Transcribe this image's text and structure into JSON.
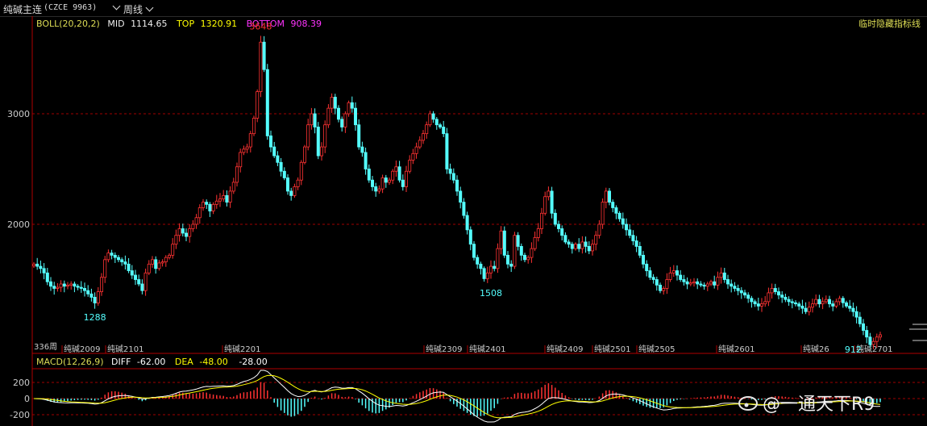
{
  "header": {
    "instrument": "纯碱主连",
    "code": "(CZCE 9963)",
    "period": "周线"
  },
  "boll": {
    "label": "BOLL(20,20,2)",
    "mid_label": "MID",
    "mid": "1114.65",
    "top_label": "TOP",
    "top": "1320.91",
    "bottom_label": "BOTTOM",
    "bottom": "908.39"
  },
  "hide_indicator_label": "临时隐藏指标线",
  "macd": {
    "label": "MACD(12,26,9)",
    "diff_label": "DIFF",
    "diff": "-62.00",
    "dea_label": "DEA",
    "dea": "-48.00",
    "bar_value": "-28.00"
  },
  "bar_count_label": "336周",
  "watermark": "@一通天下R9",
  "colors": {
    "up": "#ff3232",
    "down": "#54ffff",
    "grid": "#b00000",
    "axis": "#b00000",
    "diff": "#ffffff",
    "dea": "#ffff00"
  },
  "chart_data": [
    {
      "type": "candlestick",
      "price_ylim": [
        1000,
        3700
      ],
      "y_ticks": [
        "3000",
        "2000"
      ],
      "annotations": [
        {
          "label": "3648",
          "index": 67,
          "value": 3648
        },
        {
          "label": "1288",
          "index": 18,
          "value": 1288
        },
        {
          "label": "1508",
          "index": 135,
          "value": 1508
        },
        {
          "label": "912",
          "index": 242,
          "value": 912
        }
      ],
      "x_labels": [
        "纯碱2009",
        "纯碱2101",
        "纯碱2201",
        "纯碱2309",
        "纯碱2401",
        "纯碱2409",
        "纯碱2501",
        "纯碱2505",
        "纯碱2601",
        "纯碱26",
        "纯碱2701"
      ],
      "closes": [
        1640,
        1620,
        1600,
        1560,
        1480,
        1440,
        1420,
        1430,
        1460,
        1440,
        1450,
        1460,
        1440,
        1430,
        1420,
        1400,
        1370,
        1340,
        1288,
        1390,
        1520,
        1680,
        1740,
        1720,
        1700,
        1680,
        1660,
        1640,
        1580,
        1540,
        1500,
        1460,
        1400,
        1560,
        1640,
        1680,
        1600,
        1650,
        1660,
        1700,
        1720,
        1820,
        1900,
        1960,
        1920,
        1890,
        1960,
        2000,
        2060,
        2150,
        2200,
        2180,
        2120,
        2180,
        2210,
        2230,
        2260,
        2200,
        2300,
        2380,
        2520,
        2650,
        2680,
        2700,
        2820,
        2960,
        3200,
        3648,
        3400,
        2800,
        2700,
        2620,
        2560,
        2480,
        2420,
        2300,
        2260,
        2340,
        2400,
        2560,
        2700,
        2900,
        3000,
        2880,
        2620,
        2700,
        2900,
        3050,
        3150,
        3050,
        2950,
        2880,
        3000,
        3100,
        3050,
        2900,
        2700,
        2650,
        2500,
        2400,
        2340,
        2300,
        2320,
        2420,
        2380,
        2400,
        2480,
        2520,
        2400,
        2340,
        2480,
        2580,
        2640,
        2700,
        2760,
        2820,
        2900,
        3000,
        2950,
        2900,
        2880,
        2820,
        2500,
        2460,
        2400,
        2300,
        2200,
        2080,
        1950,
        1820,
        1700,
        1640,
        1600,
        1508,
        1560,
        1620,
        1600,
        1780,
        1940,
        1720,
        1640,
        1620,
        1900,
        1800,
        1720,
        1680,
        1700,
        1780,
        1880,
        1960,
        2100,
        2250,
        2300,
        2100,
        2000,
        1960,
        1900,
        1840,
        1820,
        1780,
        1820,
        1780,
        1840,
        1800,
        1760,
        1820,
        1900,
        2000,
        2200,
        2300,
        2200,
        2150,
        2100,
        2050,
        2000,
        1950,
        1900,
        1850,
        1800,
        1720,
        1640,
        1580,
        1520,
        1500,
        1450,
        1400,
        1420,
        1500,
        1560,
        1580,
        1540,
        1500,
        1480,
        1460,
        1470,
        1480,
        1460,
        1450,
        1440,
        1460,
        1480,
        1450,
        1520,
        1560,
        1500,
        1460,
        1440,
        1420,
        1400,
        1380,
        1360,
        1330,
        1300,
        1280,
        1260,
        1280,
        1300,
        1380,
        1420,
        1390,
        1360,
        1340,
        1320,
        1300,
        1290,
        1280,
        1260,
        1240,
        1210,
        1250,
        1280,
        1320,
        1280,
        1300,
        1320,
        1280,
        1260,
        1300,
        1330,
        1290,
        1260,
        1240,
        1210,
        1160,
        1100,
        1040,
        980,
        912,
        940,
        980,
        1000
      ]
    },
    {
      "type": "macd",
      "ylim": [
        -300,
        350
      ],
      "y_ticks": [
        "200",
        "0",
        "-200"
      ]
    }
  ]
}
